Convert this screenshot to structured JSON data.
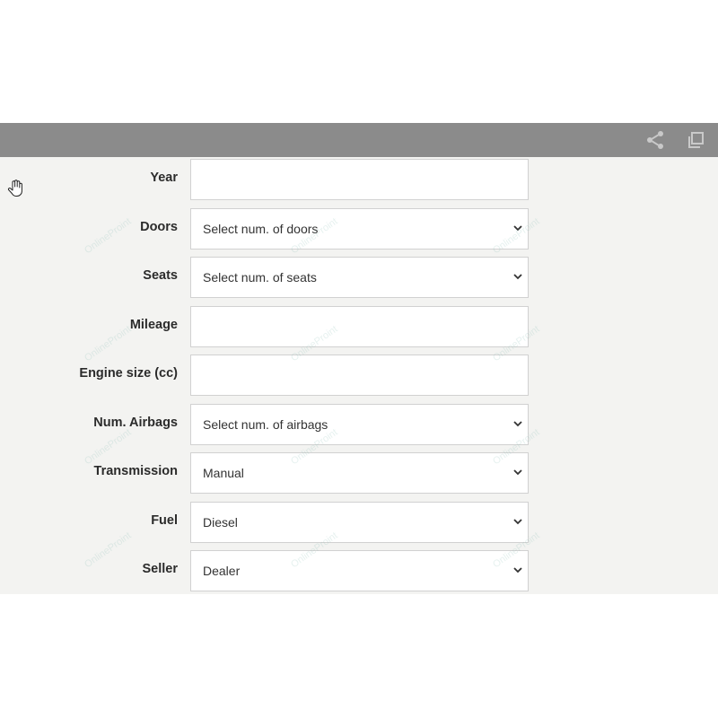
{
  "topbar": {
    "share_icon": "share-icon",
    "copy_icon": "copy-icon"
  },
  "cursor_icon": "hand-pointer-icon",
  "watermark": "OnlineProint",
  "form": {
    "fields": [
      {
        "label": "Year",
        "type": "text",
        "value": ""
      },
      {
        "label": "Doors",
        "type": "select",
        "value": "Select num. of doors"
      },
      {
        "label": "Seats",
        "type": "select",
        "value": "Select num. of seats"
      },
      {
        "label": "Mileage",
        "type": "text",
        "value": ""
      },
      {
        "label": "Engine size (cc)",
        "type": "text",
        "value": ""
      },
      {
        "label": "Num. Airbags",
        "type": "select",
        "value": "Select num. of airbags"
      },
      {
        "label": "Transmission",
        "type": "select",
        "value": "Manual"
      },
      {
        "label": "Fuel",
        "type": "select",
        "value": "Diesel"
      },
      {
        "label": "Seller",
        "type": "select",
        "value": "Dealer"
      }
    ]
  }
}
